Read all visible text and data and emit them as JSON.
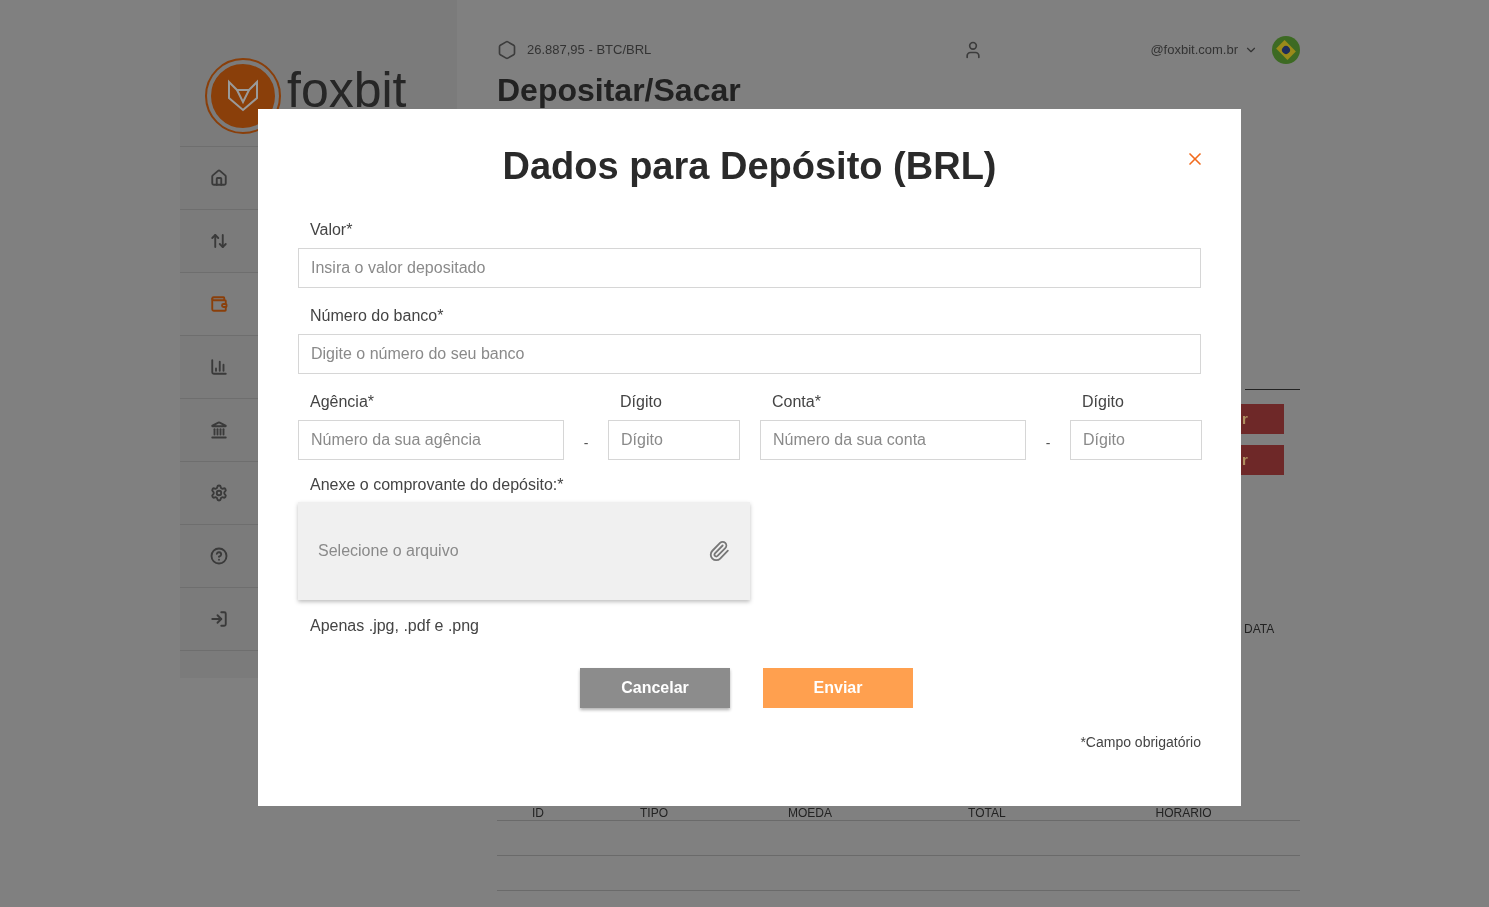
{
  "sidebar": {
    "logo": "foxbit",
    "items": [
      {
        "kind": "home",
        "selected": false
      },
      {
        "kind": "exchange",
        "selected": false
      },
      {
        "kind": "wallet",
        "selected": true
      },
      {
        "kind": "report",
        "selected": false
      },
      {
        "kind": "bank",
        "selected": false
      },
      {
        "kind": "settings",
        "selected": false
      },
      {
        "kind": "help",
        "selected": false
      },
      {
        "kind": "logout",
        "selected": false
      }
    ]
  },
  "header": {
    "ticker": "26.887,95 - BTC/BRL",
    "account": "@foxbit.com.br"
  },
  "page_title": "Depositar/Sacar",
  "background_buttons": [
    "r",
    "r"
  ],
  "background_table": {
    "columns": [
      "ID",
      "TIPO",
      "MOEDA",
      "TOTAL",
      "HORARIO"
    ],
    "side_column": "DATA"
  },
  "modal": {
    "title": "Dados para Depósito (BRL)",
    "fields": [
      {
        "label": "Valor*",
        "placeholder": "Insira o valor depositado"
      },
      {
        "label": "Número do banco*",
        "placeholder": "Digite o número do seu banco"
      }
    ],
    "split_fields": [
      {
        "label": "Agência*",
        "placeholder": "Número da sua agência",
        "separator": "-",
        "digit": {
          "label": "Dígito",
          "placeholder": "Dígito"
        }
      },
      {
        "label": "Conta*",
        "placeholder": "Número da sua conta",
        "separator": "-",
        "digit": {
          "label": "Dígito",
          "placeholder": "Dígito"
        }
      }
    ],
    "attachment": {
      "label": "Anexe o comprovante do depósito:*",
      "placeholder": "Selecione o arquivo",
      "hint": "Apenas .jpg, .pdf e .png"
    },
    "buttons": [
      {
        "kind": "secondary",
        "label": "Cancelar"
      },
      {
        "kind": "primary",
        "label": "Enviar"
      }
    ],
    "footnote": "*Campo obrigatório"
  }
}
